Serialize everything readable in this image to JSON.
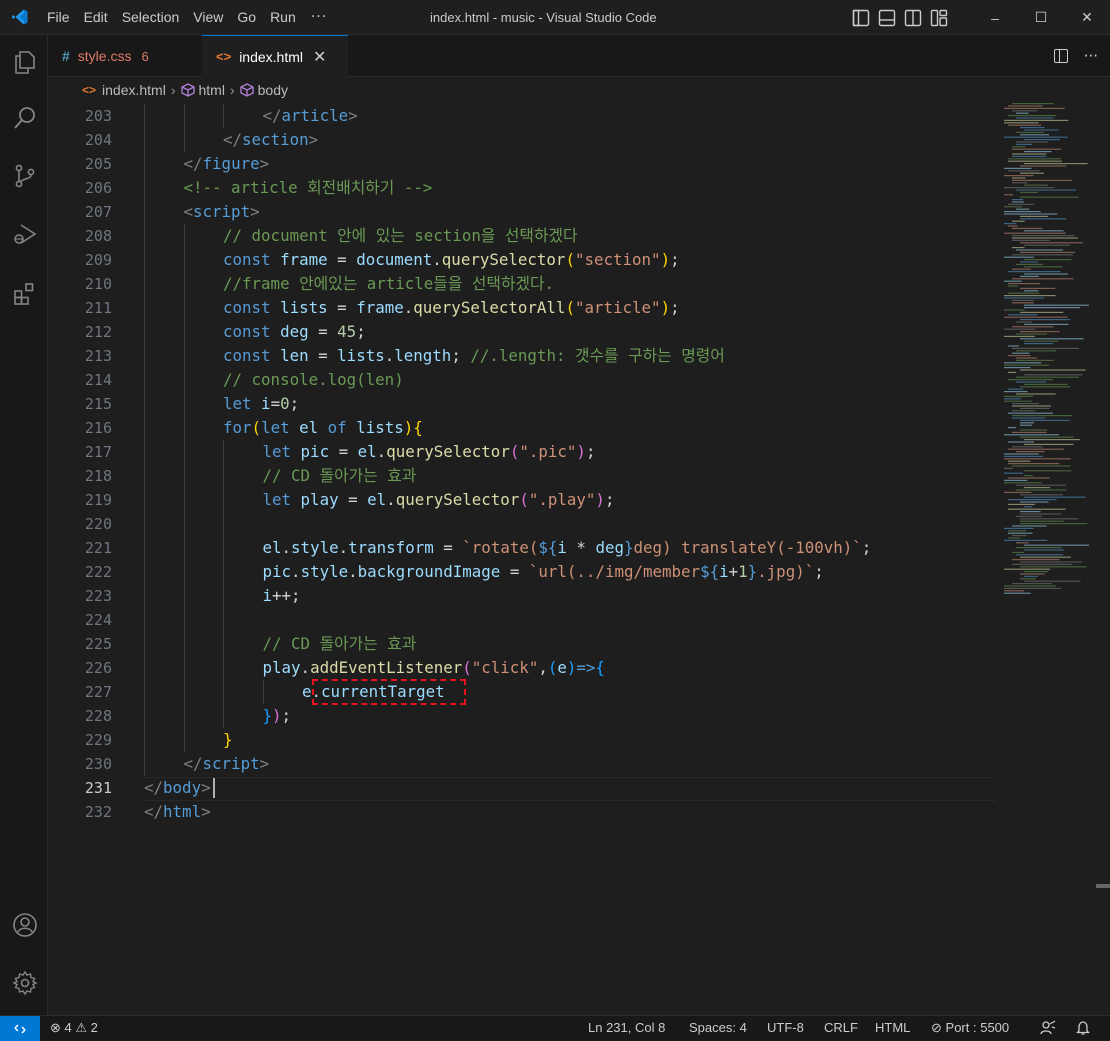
{
  "window": {
    "title": "index.html - music - Visual Studio Code"
  },
  "menu": [
    "File",
    "Edit",
    "Selection",
    "View",
    "Go",
    "Run"
  ],
  "menu_more": "···",
  "window_controls": {
    "minimize": "–",
    "maximize": "☐",
    "close": "✕"
  },
  "activity_bar": [
    "explorer-icon",
    "search-icon",
    "source-control-icon",
    "run-debug-icon",
    "extensions-icon",
    "account-icon",
    "settings-gear-icon"
  ],
  "tabs": [
    {
      "label": "style.css",
      "badge": "6",
      "icon": "#",
      "active": false
    },
    {
      "label": "index.html",
      "icon": "<>",
      "close": "✕",
      "active": true
    }
  ],
  "tab_actions": {
    "more": "···"
  },
  "breadcrumb": {
    "file_icon": "<>",
    "file": "index.html",
    "sep": "›",
    "items": [
      "html",
      "body"
    ]
  },
  "editor": {
    "current_line": 231,
    "lines": [
      {
        "n": "203",
        "indent": 6,
        "tokens": [
          [
            "punc",
            "</"
          ],
          [
            "tag",
            "article"
          ],
          [
            "punc",
            ">"
          ]
        ]
      },
      {
        "n": "204",
        "indent": 5,
        "tokens": [
          [
            "punc",
            "</"
          ],
          [
            "tag",
            "section"
          ],
          [
            "punc",
            ">"
          ]
        ]
      },
      {
        "n": "205",
        "indent": 4,
        "tokens": [
          [
            "punc",
            "</"
          ],
          [
            "tag",
            "figure"
          ],
          [
            "punc",
            ">"
          ]
        ]
      },
      {
        "n": "206",
        "indent": 4,
        "tokens": [
          [
            "com",
            "<!-- article 회전배치하기 -->"
          ]
        ]
      },
      {
        "n": "207",
        "indent": 4,
        "tokens": [
          [
            "punc",
            "<"
          ],
          [
            "tag",
            "script"
          ],
          [
            "punc",
            ">"
          ]
        ]
      },
      {
        "n": "208",
        "indent": 5,
        "tokens": [
          [
            "com",
            "// document 안에 있는 section을 선택하겠다"
          ]
        ]
      },
      {
        "n": "209",
        "indent": 5,
        "tokens": [
          [
            "kw",
            "const "
          ],
          [
            "var",
            "frame"
          ],
          [
            "plain",
            " = "
          ],
          [
            "var",
            "document"
          ],
          [
            "plain",
            "."
          ],
          [
            "fn",
            "querySelector"
          ],
          [
            "br1",
            "("
          ],
          [
            "str",
            "\"section\""
          ],
          [
            "br1",
            ")"
          ],
          [
            "plain",
            ";"
          ]
        ]
      },
      {
        "n": "210",
        "indent": 5,
        "tokens": [
          [
            "com",
            "//frame 안에있는 article들을 선택하겠다."
          ]
        ]
      },
      {
        "n": "211",
        "indent": 5,
        "tokens": [
          [
            "kw",
            "const "
          ],
          [
            "var",
            "lists"
          ],
          [
            "plain",
            " = "
          ],
          [
            "var",
            "frame"
          ],
          [
            "plain",
            "."
          ],
          [
            "fn",
            "querySelectorAll"
          ],
          [
            "br1",
            "("
          ],
          [
            "str",
            "\"article\""
          ],
          [
            "br1",
            ")"
          ],
          [
            "plain",
            ";"
          ]
        ]
      },
      {
        "n": "212",
        "indent": 5,
        "tokens": [
          [
            "kw",
            "const "
          ],
          [
            "var",
            "deg"
          ],
          [
            "plain",
            " = "
          ],
          [
            "num",
            "45"
          ],
          [
            "plain",
            ";"
          ]
        ]
      },
      {
        "n": "213",
        "indent": 5,
        "tokens": [
          [
            "kw",
            "const "
          ],
          [
            "var",
            "len"
          ],
          [
            "plain",
            " = "
          ],
          [
            "var",
            "lists"
          ],
          [
            "plain",
            "."
          ],
          [
            "var",
            "length"
          ],
          [
            "plain",
            "; "
          ],
          [
            "com",
            "//.length: 갯수를 구하는 명령어"
          ]
        ]
      },
      {
        "n": "214",
        "indent": 5,
        "tokens": [
          [
            "com",
            "// console.log(len)"
          ]
        ]
      },
      {
        "n": "215",
        "indent": 5,
        "tokens": [
          [
            "kw",
            "let "
          ],
          [
            "var",
            "i"
          ],
          [
            "plain",
            "="
          ],
          [
            "num",
            "0"
          ],
          [
            "plain",
            ";"
          ]
        ]
      },
      {
        "n": "216",
        "indent": 5,
        "tokens": [
          [
            "kw",
            "for"
          ],
          [
            "br1",
            "("
          ],
          [
            "kw",
            "let "
          ],
          [
            "var",
            "el"
          ],
          [
            "kw",
            " of "
          ],
          [
            "var",
            "lists"
          ],
          [
            "br1",
            ")"
          ],
          [
            "br1",
            "{"
          ]
        ]
      },
      {
        "n": "217",
        "indent": 6,
        "tokens": [
          [
            "kw",
            "let "
          ],
          [
            "var",
            "pic"
          ],
          [
            "plain",
            " = "
          ],
          [
            "var",
            "el"
          ],
          [
            "plain",
            "."
          ],
          [
            "fn",
            "querySelector"
          ],
          [
            "br2",
            "("
          ],
          [
            "str",
            "\".pic\""
          ],
          [
            "br2",
            ")"
          ],
          [
            "plain",
            ";"
          ]
        ]
      },
      {
        "n": "218",
        "indent": 6,
        "tokens": [
          [
            "com",
            "// CD 돌아가는 효과"
          ]
        ]
      },
      {
        "n": "219",
        "indent": 6,
        "tokens": [
          [
            "kw",
            "let "
          ],
          [
            "var",
            "play"
          ],
          [
            "plain",
            " = "
          ],
          [
            "var",
            "el"
          ],
          [
            "plain",
            "."
          ],
          [
            "fn",
            "querySelector"
          ],
          [
            "br2",
            "("
          ],
          [
            "str",
            "\".play\""
          ],
          [
            "br2",
            ")"
          ],
          [
            "plain",
            ";"
          ]
        ]
      },
      {
        "n": "220",
        "indent": 6,
        "tokens": []
      },
      {
        "n": "221",
        "indent": 6,
        "tokens": [
          [
            "var",
            "el"
          ],
          [
            "plain",
            "."
          ],
          [
            "var",
            "style"
          ],
          [
            "plain",
            "."
          ],
          [
            "var",
            "transform"
          ],
          [
            "plain",
            " = "
          ],
          [
            "str",
            "`rotate("
          ],
          [
            "tpldollar",
            "${"
          ],
          [
            "tplvar",
            "i"
          ],
          [
            "plain",
            " * "
          ],
          [
            "tplvar",
            "deg"
          ],
          [
            "tpldollar",
            "}"
          ],
          [
            "str",
            "deg) translateY(-100vh)`"
          ],
          [
            "plain",
            ";"
          ]
        ]
      },
      {
        "n": "222",
        "indent": 6,
        "tokens": [
          [
            "var",
            "pic"
          ],
          [
            "plain",
            "."
          ],
          [
            "var",
            "style"
          ],
          [
            "plain",
            "."
          ],
          [
            "var",
            "backgroundImage"
          ],
          [
            "plain",
            " = "
          ],
          [
            "str",
            "`url(../img/member"
          ],
          [
            "tpldollar",
            "${"
          ],
          [
            "tplvar",
            "i"
          ],
          [
            "plain",
            "+"
          ],
          [
            "num",
            "1"
          ],
          [
            "tpldollar",
            "}"
          ],
          [
            "str",
            ".jpg)`"
          ],
          [
            "plain",
            ";"
          ]
        ]
      },
      {
        "n": "223",
        "indent": 6,
        "tokens": [
          [
            "var",
            "i"
          ],
          [
            "plain",
            "++;"
          ]
        ]
      },
      {
        "n": "224",
        "indent": 6,
        "tokens": []
      },
      {
        "n": "225",
        "indent": 6,
        "tokens": [
          [
            "com",
            "// CD 돌아가는 효과"
          ]
        ]
      },
      {
        "n": "226",
        "indent": 6,
        "tokens": [
          [
            "var",
            "play"
          ],
          [
            "plain",
            "."
          ],
          [
            "fn",
            "addEventListener"
          ],
          [
            "br2",
            "("
          ],
          [
            "str",
            "\"click\""
          ],
          [
            "plain",
            ","
          ],
          [
            "br3",
            "("
          ],
          [
            "var",
            "e"
          ],
          [
            "br3",
            ")"
          ],
          [
            "kw",
            "=>"
          ],
          [
            "br3",
            "{"
          ]
        ]
      },
      {
        "n": "227",
        "indent": 7,
        "tokens": [
          [
            "var",
            "e"
          ],
          [
            "plain",
            "."
          ],
          [
            "var",
            "currentTarget"
          ]
        ]
      },
      {
        "n": "228",
        "indent": 6,
        "tokens": [
          [
            "br3",
            "}"
          ],
          [
            "br2",
            ")"
          ],
          [
            "plain",
            ";"
          ]
        ]
      },
      {
        "n": "229",
        "indent": 5,
        "tokens": [
          [
            "br1",
            "}"
          ]
        ]
      },
      {
        "n": "230",
        "indent": 4,
        "tokens": [
          [
            "punc",
            "</"
          ],
          [
            "tag",
            "script"
          ],
          [
            "punc",
            ">"
          ]
        ]
      },
      {
        "n": "231",
        "indent": 3,
        "tokens": [
          [
            "punc",
            "</"
          ],
          [
            "tag",
            "body"
          ],
          [
            "punc",
            ">"
          ]
        ]
      },
      {
        "n": "232",
        "indent": 3,
        "tokens": [
          [
            "punc",
            "</"
          ],
          [
            "tag",
            "html"
          ],
          [
            "punc",
            ">"
          ]
        ]
      }
    ]
  },
  "status_bar": {
    "errors": "4",
    "warnings": "2",
    "position": "Ln 231, Col 8",
    "spaces": "Spaces: 4",
    "encoding": "UTF-8",
    "eol": "CRLF",
    "language": "HTML",
    "port": "Port : 5500"
  },
  "colors": {
    "accent": "#0078d4",
    "highlight_box": "#e8121e"
  }
}
